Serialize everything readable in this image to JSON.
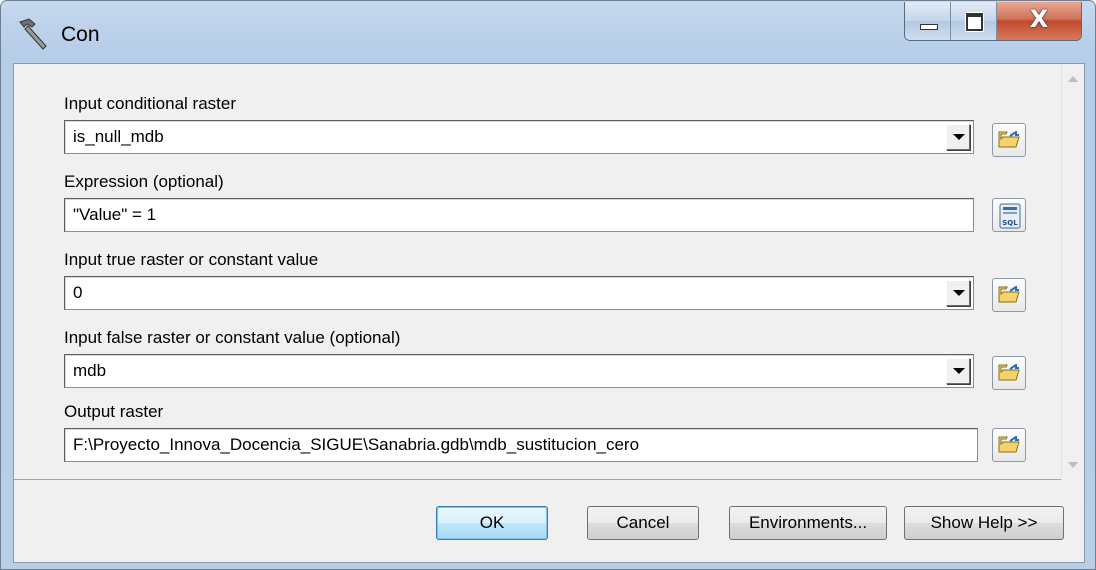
{
  "window": {
    "title": "Con",
    "icon": "hammer-icon",
    "controls": [
      "minimize-icon",
      "maximize-icon",
      "close-icon"
    ],
    "close_glyph": "X"
  },
  "form": {
    "fields": [
      {
        "label": "Input conditional raster",
        "value": "is_null_mdb",
        "type": "dropdown",
        "side_icon": "folder-browse-icon"
      },
      {
        "label": "Expression (optional)",
        "value": "\"Value\" = 1",
        "type": "text",
        "side_icon": "sql-icon"
      },
      {
        "label": "Input true raster or constant value",
        "value": "0",
        "type": "dropdown",
        "side_icon": "folder-browse-icon"
      },
      {
        "label": "Input false raster or constant value (optional)",
        "value": "mdb",
        "type": "dropdown",
        "side_icon": "folder-browse-icon"
      },
      {
        "label": "Output raster",
        "value": "F:\\Proyecto_Innova_Docencia_SIGUE\\Sanabria.gdb\\mdb_sustitucion_cero",
        "type": "text",
        "side_icon": "folder-browse-icon"
      }
    ]
  },
  "buttons": {
    "ok": "OK",
    "cancel": "Cancel",
    "environments": "Environments...",
    "show_help": "Show Help >>"
  },
  "colors": {
    "title_bar": "#bcd1ea",
    "client_bg": "#f0f0f0",
    "close_button": "#c2492b",
    "default_button": "#bee6fd"
  }
}
